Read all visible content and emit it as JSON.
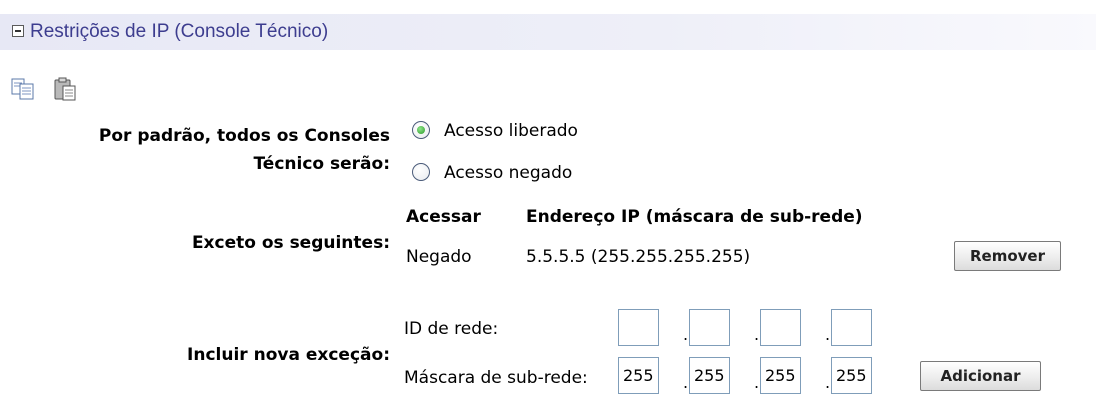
{
  "section": {
    "title": "Restrições de IP (Console Técnico)"
  },
  "toolbar": {
    "copy_icon": "copy-icon",
    "paste_icon": "paste-icon"
  },
  "default_access": {
    "label_line1": "Por padrão, todos os Consoles",
    "label_line2": "Técnico serão:",
    "options": [
      {
        "label": "Acesso liberado",
        "selected": true
      },
      {
        "label": "Acesso negado",
        "selected": false
      }
    ]
  },
  "exceptions": {
    "label": "Exceto os seguintes:",
    "columns": [
      "Acessar",
      "Endereço IP (máscara de sub-rede)"
    ],
    "rows": [
      {
        "access": "Negado",
        "ip": "5.5.5.5 (255.255.255.255)",
        "button": "Remover"
      }
    ]
  },
  "new_exception": {
    "label": "Incluir nova exceção:",
    "network_id_label": "ID de rede:",
    "network_id_values": [
      "",
      "",
      "",
      ""
    ],
    "subnet_mask_label": "Máscara de sub-rede:",
    "subnet_mask_values": [
      "255",
      "255",
      "255",
      "255"
    ],
    "button": "Adicionar"
  },
  "colors": {
    "header_bg": "#e7e8f5",
    "title_color": "#3d3d8f",
    "radio_selected": "#2b9a2b",
    "input_border": "#7f9db9"
  }
}
